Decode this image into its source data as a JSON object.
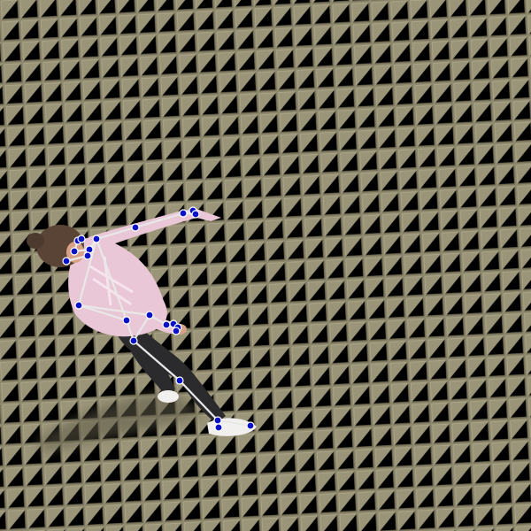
{
  "image": {
    "subject": "figure-with-pose-keypoints",
    "background": "paving-stone-ground"
  },
  "colors": {
    "ground": "#8f8a6f",
    "tile_line": "#6f6a52",
    "tile_highlight": "#a9a486",
    "shadow": "#5e5a46",
    "top": "#e9c7d6",
    "pants": "#2b2a2c",
    "skin": "#d9a088",
    "hair": "#5a4436",
    "shoe": "#f1f0ee",
    "skeleton_line": "#e8e8e8",
    "keypoint_fill": "#0a12c8",
    "keypoint_stroke": "#ffffff"
  },
  "pose": {
    "keypoint_count": 26,
    "bone_count": 22
  }
}
